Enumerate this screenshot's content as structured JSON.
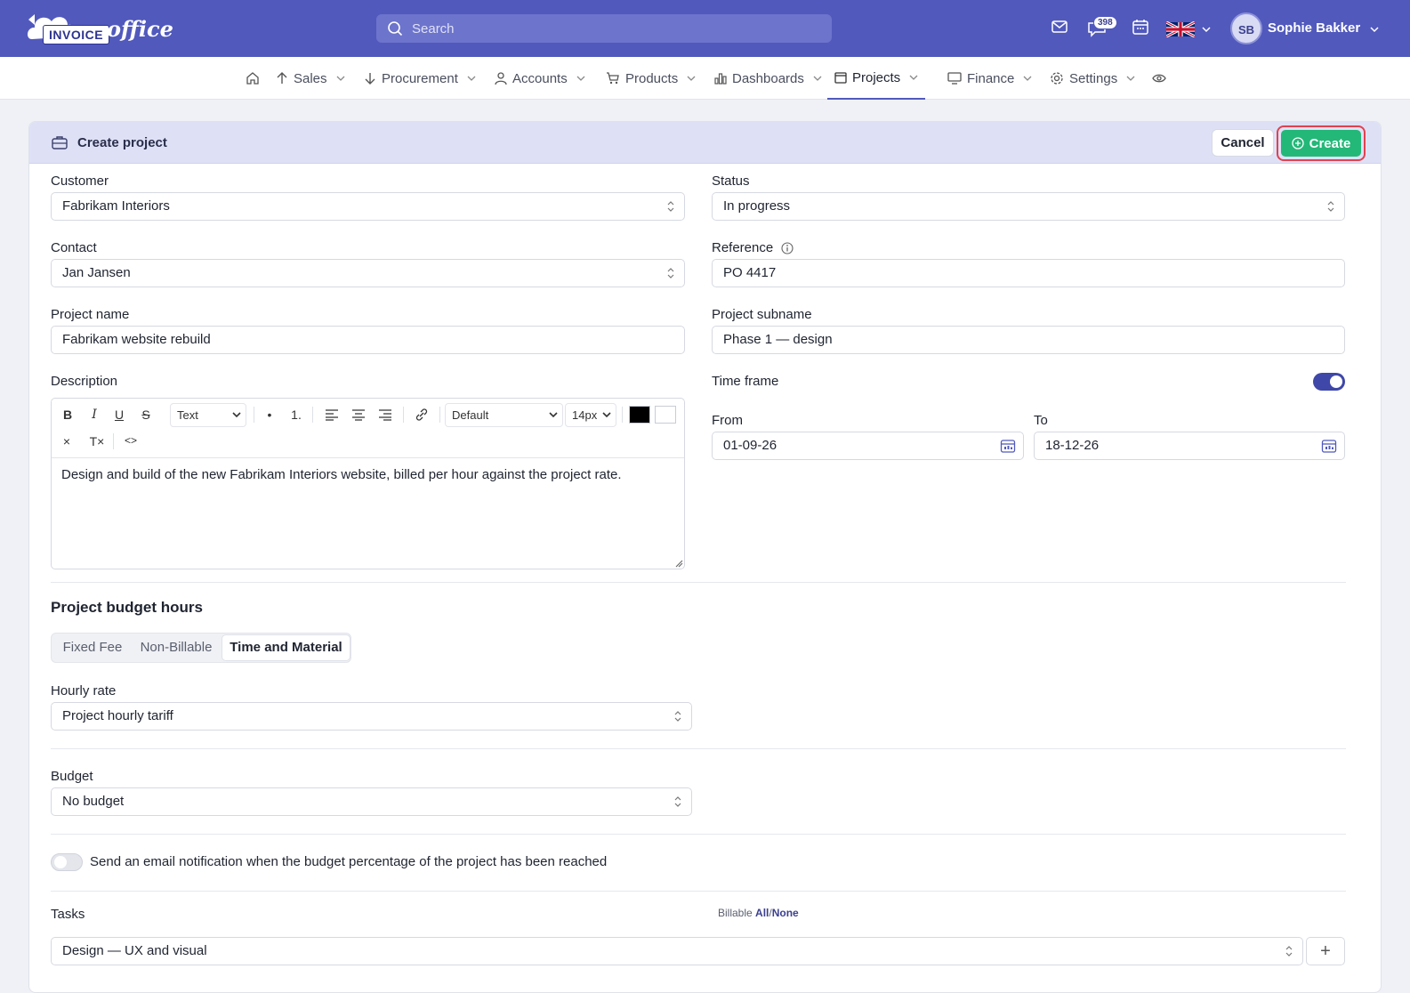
{
  "app": {
    "logo_text": "INVOICE office",
    "search_placeholder": "Search",
    "notifications_count": "398",
    "user_initials": "SB",
    "user_name": "Sophie Bakker"
  },
  "nav": {
    "items": [
      {
        "label": "Sales"
      },
      {
        "label": "Procurement"
      },
      {
        "label": "Accounts"
      },
      {
        "label": "Products"
      },
      {
        "label": "Dashboards"
      },
      {
        "label": "Projects"
      },
      {
        "label": "Finance"
      },
      {
        "label": "Settings"
      }
    ],
    "active": "Projects"
  },
  "form": {
    "title": "Create project",
    "cancel_label": "Cancel",
    "create_label": "Create",
    "customer": {
      "label": "Customer",
      "value": "Fabrikam Interiors"
    },
    "status": {
      "label": "Status",
      "value": "In progress"
    },
    "contact": {
      "label": "Contact",
      "value": "Jan Jansen"
    },
    "reference": {
      "label": "Reference",
      "value": "PO 4417"
    },
    "project_name": {
      "label": "Project name",
      "value": "Fabrikam website rebuild"
    },
    "project_subname": {
      "label": "Project subname",
      "value": "Phase 1 — design"
    },
    "description": {
      "label": "Description",
      "text": "Design and build of the new Fabrikam Interiors website, billed per hour against the project rate.",
      "toolbar": {
        "bold": "B",
        "italic": "I",
        "underline": "U",
        "strike": "S",
        "format": "Text",
        "bullet": "•",
        "numbered": "1.",
        "font": "Default",
        "size": "14px",
        "clear": "×",
        "clear_format": "T×",
        "code": "<>"
      },
      "text_color": "#000000",
      "bg_color": "#ffffff"
    },
    "time_frame": {
      "label": "Time frame",
      "enabled": true
    },
    "from": {
      "label": "From",
      "value": "01-09-26"
    },
    "to": {
      "label": "To",
      "value": "18-12-26"
    },
    "budget_section": "Project budget hours",
    "budget_types": [
      "Fixed Fee",
      "Non-Billable",
      "Time and Material"
    ],
    "budget_type_selected": "Time and Material",
    "hourly_rate": {
      "label": "Hourly rate",
      "value": "Project hourly tariff"
    },
    "budget": {
      "label": "Budget",
      "value": "No budget"
    },
    "notify": {
      "label": "Send an email notification when the budget percentage of the project has been reached",
      "enabled": false
    },
    "tasks": {
      "label": "Tasks",
      "billable_label": "Billable",
      "all_label": "All",
      "slash": "/",
      "none_label": "None",
      "first_task": "Design — UX and visual",
      "add_label": "+"
    }
  },
  "colors": {
    "topbar": "#5159bd",
    "accent": "#3f47a8",
    "create": "#23b878",
    "highlight": "#e0424f"
  }
}
